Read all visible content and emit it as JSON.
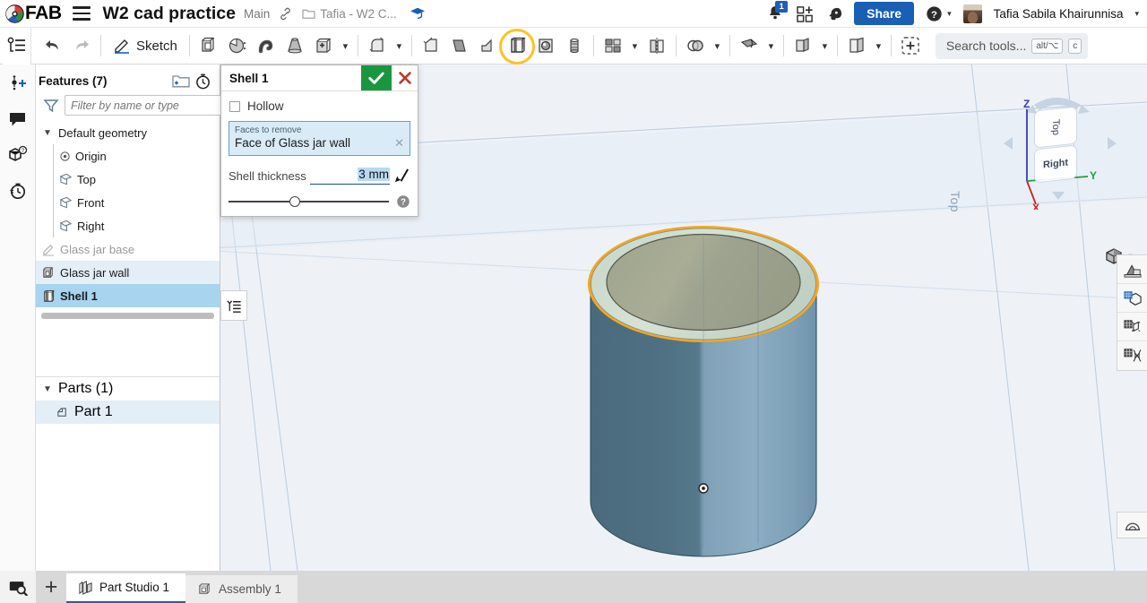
{
  "header": {
    "logo_text": "FAB",
    "logo_icon": "fab-logo-icon",
    "menu_icon": "hamburger-menu-icon",
    "document_title": "W2 cad practice",
    "branch": "Main",
    "link_icon": "link-icon",
    "folder_icon": "folder-icon",
    "breadcrumb": "Tafia - W2 C...",
    "graduation_icon": "graduation-cap-icon",
    "notification_icon": "bell-icon",
    "notification_count": "1",
    "apps_icon": "add-app-icon",
    "brain_icon": "ai-assistant-icon",
    "share_label": "Share",
    "help_icon": "help-circle-icon",
    "help_caret": "▾",
    "avatar_icon": "user-avatar",
    "user_name": "Tafia Sabila Khairunnisa",
    "user_caret": "▾"
  },
  "toolbar": {
    "feature_list_icon": "feature-list-icon",
    "undo_icon": "undo-icon",
    "redo_icon": "redo-icon",
    "sketch_icon": "sketch-pencil-icon",
    "sketch_label": "Sketch",
    "tools": [
      {
        "name": "extrude-tool",
        "icon": "extrude-icon"
      },
      {
        "name": "revolve-tool",
        "icon": "revolve-icon"
      },
      {
        "name": "sweep-tool",
        "icon": "sweep-icon"
      },
      {
        "name": "loft-tool",
        "icon": "loft-icon"
      },
      {
        "name": "boolean-tool",
        "icon": "boolean-icon"
      },
      {
        "name": "fillet-tool",
        "icon": "fillet-icon"
      },
      {
        "name": "chamfer-tool",
        "icon": "chamfer-icon"
      },
      {
        "name": "draft-tool",
        "icon": "draft-icon"
      },
      {
        "name": "rib-tool",
        "icon": "rib-icon"
      },
      {
        "name": "shell-tool",
        "icon": "shell-icon"
      },
      {
        "name": "hole-tool",
        "icon": "hole-icon"
      },
      {
        "name": "thread-tool",
        "icon": "thread-icon"
      },
      {
        "name": "pattern-tool",
        "icon": "pattern-icon"
      },
      {
        "name": "mirror-tool",
        "icon": "mirror-icon"
      },
      {
        "name": "transform-tool",
        "icon": "transform-icon"
      },
      {
        "name": "plane-tool",
        "icon": "plane-icon"
      },
      {
        "name": "sheet-metal-tool",
        "icon": "sheet-metal-icon"
      },
      {
        "name": "variable-tool",
        "icon": "variable-icon"
      },
      {
        "name": "insert-feature",
        "icon": "add-dashed-icon"
      }
    ],
    "highlighted_tool": "shell-tool",
    "highlight_color": "#ffc125",
    "search_placeholder": "Search tools...",
    "search_kbd_1": "alt/⌥",
    "search_kbd_2": "c"
  },
  "left_rail": {
    "items": [
      {
        "name": "insert-feature-rail",
        "icon": "add-feature-icon"
      },
      {
        "name": "comments-rail",
        "icon": "comment-bubble-icon"
      },
      {
        "name": "versions-rail",
        "icon": "cube-question-icon"
      },
      {
        "name": "history-rail",
        "icon": "stopwatch-history-icon"
      }
    ]
  },
  "features_panel": {
    "title": "Features (7)",
    "new_folder_icon": "new-folder-icon",
    "rollback_icon": "stopwatch-icon",
    "filter_icon": "funnel-filter-icon",
    "filter_placeholder": "Filter by name or type",
    "tree": [
      {
        "label": "Default geometry",
        "icon": "chevron-down-icon",
        "level": 0,
        "state": "group"
      },
      {
        "label": "Origin",
        "icon": "origin-point-icon",
        "level": 1,
        "state": "normal"
      },
      {
        "label": "Top",
        "icon": "plane-icon",
        "level": 1,
        "state": "normal"
      },
      {
        "label": "Front",
        "icon": "plane-icon",
        "level": 1,
        "state": "normal"
      },
      {
        "label": "Right",
        "icon": "plane-icon",
        "level": 1,
        "state": "normal"
      },
      {
        "label": "Glass jar base",
        "icon": "sketch-pencil-icon",
        "level": 0,
        "state": "dim"
      },
      {
        "label": "Glass jar wall",
        "icon": "extrude-icon",
        "level": 0,
        "state": "sel-light"
      },
      {
        "label": "Shell 1",
        "icon": "shell-icon",
        "level": 0,
        "state": "sel-strong"
      }
    ],
    "parts_title": "Parts (1)",
    "parts_caret": "chevron-down-icon",
    "parts": [
      {
        "label": "Part 1",
        "icon": "part-icon"
      }
    ]
  },
  "shell_dialog": {
    "title": "Shell 1",
    "accept_icon": "checkmark-icon",
    "cancel_icon": "close-x-icon",
    "accept_color": "#1a9641",
    "cancel_color": "#c0392b",
    "hollow_label": "Hollow",
    "hollow_checked": false,
    "faces_legend": "Faces to remove",
    "faces_value": "Face of Glass jar wall",
    "faces_clear_icon": "clear-x-icon",
    "thickness_label": "Shell thickness",
    "thickness_value": "3 mm",
    "thickness_pick_icon": "arrow-pick-icon",
    "help_icon": "help-circle-icon",
    "slider_position_pct": 45
  },
  "viewport": {
    "plane_label": "Top",
    "viewcube": {
      "top_face": "Top",
      "right_face": "Right",
      "axis_z": "Z",
      "axis_y": "Y",
      "axis_x": "X",
      "axis_z_color": "#3a3ab0",
      "axis_y_color": "#1f9e3e",
      "axis_x_color": "#cc2222"
    },
    "view_mode_icon": "shaded-cube-icon",
    "view_mode_caret": "▾",
    "rollback_bar_icon": "rollback-list-icon",
    "right_tools": [
      {
        "name": "appearance-tool",
        "icon": "appearance-icon"
      },
      {
        "name": "render-studio-tool",
        "icon": "render-cube-icon"
      },
      {
        "name": "simulation-tool",
        "icon": "simulation-icon"
      },
      {
        "name": "fea-tool",
        "icon": "fea-icon"
      }
    ],
    "bottom_right_tool": {
      "name": "section-view-tool",
      "icon": "section-view-icon"
    },
    "model": {
      "name": "glass-jar-cylinder",
      "body_color": "#4d6d80",
      "body_highlight_color": "#8fb1c4",
      "top_face_color": "#a4a890",
      "rim_color": "#bfd0c4",
      "selection_outline_color": "#f5a623",
      "origin_marker": "origin-point-icon"
    }
  },
  "bottom_bar": {
    "search_icon": "search-panel-icon",
    "add_tab_icon": "+",
    "tabs": [
      {
        "label": "Part Studio 1",
        "icon": "part-studio-icon",
        "active": true
      },
      {
        "label": "Assembly 1",
        "icon": "assembly-icon",
        "active": false
      }
    ]
  }
}
